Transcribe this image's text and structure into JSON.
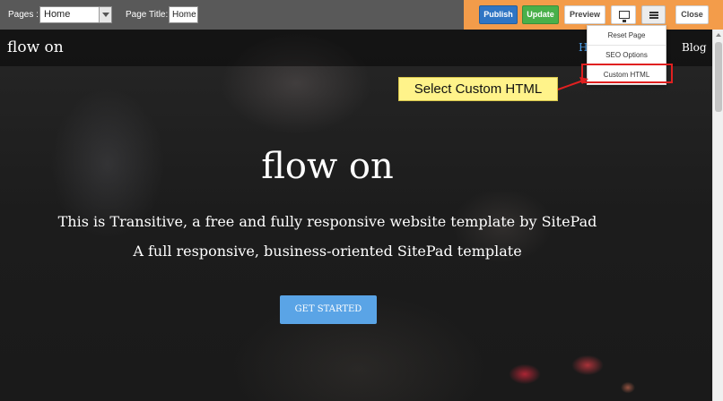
{
  "toolbar": {
    "pages_label": "Pages :",
    "pages_selected": "Home",
    "page_title_label": "Page Title:",
    "page_title_value": "Home",
    "publish_label": "Publish",
    "update_label": "Update",
    "preview_label": "Preview",
    "device_icon": "monitor-icon",
    "menu_icon": "hamburger-icon",
    "close_label": "Close"
  },
  "menu": {
    "items": [
      "Reset Page",
      "SEO Options",
      "Custom HTML"
    ],
    "highlighted": "Custom HTML"
  },
  "annotation": {
    "text": "Select Custom HTML",
    "color": "#fff38a",
    "border_color": "#e02020"
  },
  "site": {
    "brand": "flow on",
    "nav": [
      "H",
      "Blog"
    ],
    "hero_title": "flow on",
    "hero_line1": "This is Transitive, a free and fully responsive website template by SitePad",
    "hero_line2": "A full responsive, business-oriented SitePad template",
    "cta_label": "GET STARTED"
  },
  "colors": {
    "toolbar_bg": "#595959",
    "toolbar_accent": "#f39c4a",
    "publish": "#2f75c4",
    "update": "#49b04a",
    "cta": "#5aa4e6",
    "nav_active": "#4da3f0"
  }
}
